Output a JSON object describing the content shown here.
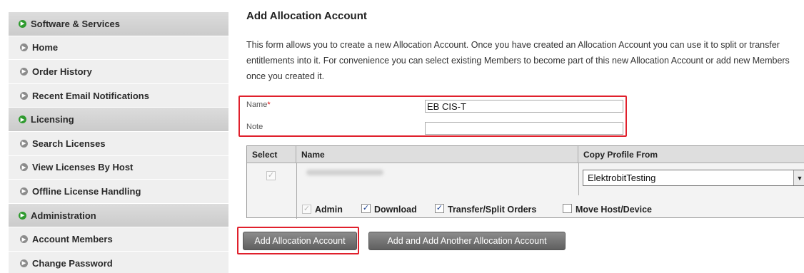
{
  "sidebar": {
    "items": [
      {
        "label": "Software & Services",
        "type": "section"
      },
      {
        "label": "Home",
        "type": "item"
      },
      {
        "label": "Order History",
        "type": "item"
      },
      {
        "label": "Recent Email Notifications",
        "type": "item"
      },
      {
        "label": "Licensing",
        "type": "section"
      },
      {
        "label": "Search Licenses",
        "type": "item"
      },
      {
        "label": "View Licenses By Host",
        "type": "item"
      },
      {
        "label": "Offline License Handling",
        "type": "item"
      },
      {
        "label": "Administration",
        "type": "section"
      },
      {
        "label": "Account Members",
        "type": "item"
      },
      {
        "label": "Change Password",
        "type": "item"
      }
    ]
  },
  "page": {
    "title": "Add Allocation Account",
    "intro": "This form allows you to create a new Allocation Account. Once you have created an Allocation Account you can use it to split or transfer entitlements into it. For convenience you can select existing Members to become part of this new Allocation Account or add new Members once you created it."
  },
  "form": {
    "name_label": "Name",
    "required_mark": "*",
    "name_value": "EB CIS-T",
    "note_label": "Note",
    "note_value": ""
  },
  "members": {
    "headers": {
      "select": "Select",
      "name": "Name",
      "copy_profile": "Copy Profile From"
    },
    "row": {
      "selected": true,
      "profile": "ElektrobitTesting",
      "options": [
        {
          "label": "Admin",
          "checked": true,
          "disabled": true
        },
        {
          "label": "Download",
          "checked": true,
          "disabled": false
        },
        {
          "label": "Transfer/Split Orders",
          "checked": true,
          "disabled": false
        },
        {
          "label": "Move Host/Device",
          "checked": false,
          "disabled": false
        }
      ]
    }
  },
  "buttons": {
    "add": "Add Allocation Account",
    "add_another": "Add and Add Another Allocation Account"
  },
  "colors": {
    "highlight": "#e0202c",
    "section_bullet": "#2e9a2e",
    "item_bullet": "#8c8c8c"
  },
  "icons": {
    "section_bullet": "green-arrow-bullet-icon",
    "item_bullet": "grey-arrow-bullet-icon",
    "select_arrow": "chevron-down-icon"
  }
}
